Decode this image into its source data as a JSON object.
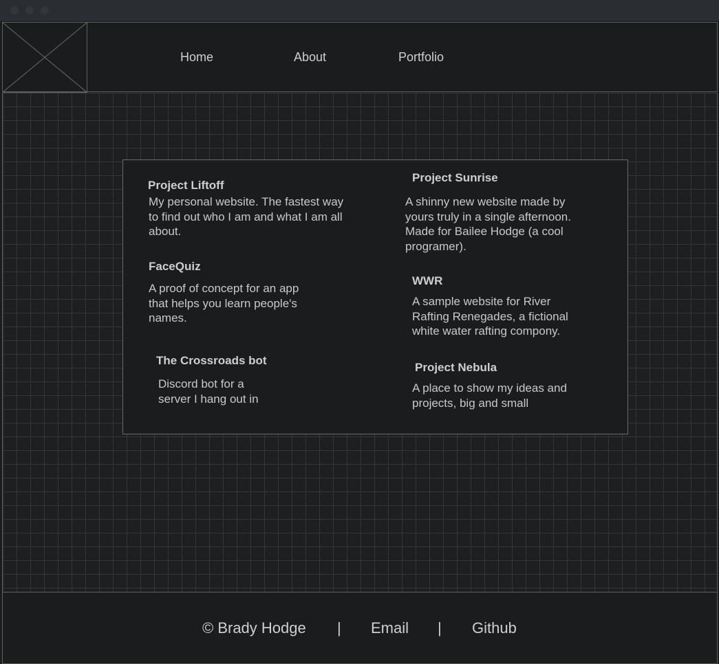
{
  "nav": {
    "items": [
      {
        "label": "Home"
      },
      {
        "label": "About"
      },
      {
        "label": "Portfolio"
      }
    ]
  },
  "logo": {
    "icon": "image-placeholder-icon"
  },
  "projects": [
    {
      "title": "Project Liftoff",
      "description": "My personal website. The fastest way to find out who I am and what I am all about."
    },
    {
      "title": "Project Sunrise",
      "description": "A shinny new website made by yours truly in a single afternoon. Made for Bailee Hodge (a cool programer)."
    },
    {
      "title": "FaceQuiz",
      "description": "A proof of concept for an app that helps you learn people's names."
    },
    {
      "title": "WWR",
      "description": "A sample website for River Rafting Renegades, a fictional white water rafting compony."
    },
    {
      "title": "The Crossroads bot",
      "description": "Discord bot for a server I hang out in"
    },
    {
      "title": "Project Nebula",
      "description": "A place to show my ideas and projects, big and small"
    }
  ],
  "footer": {
    "copyright": "© Brady Hodge",
    "separator": "|",
    "email_label": "Email",
    "github_label": "Github"
  },
  "colors": {
    "background": "#1b1c1e",
    "grid_line": "#34363a",
    "border": "#5f605b",
    "text": "#cfcfcf"
  }
}
